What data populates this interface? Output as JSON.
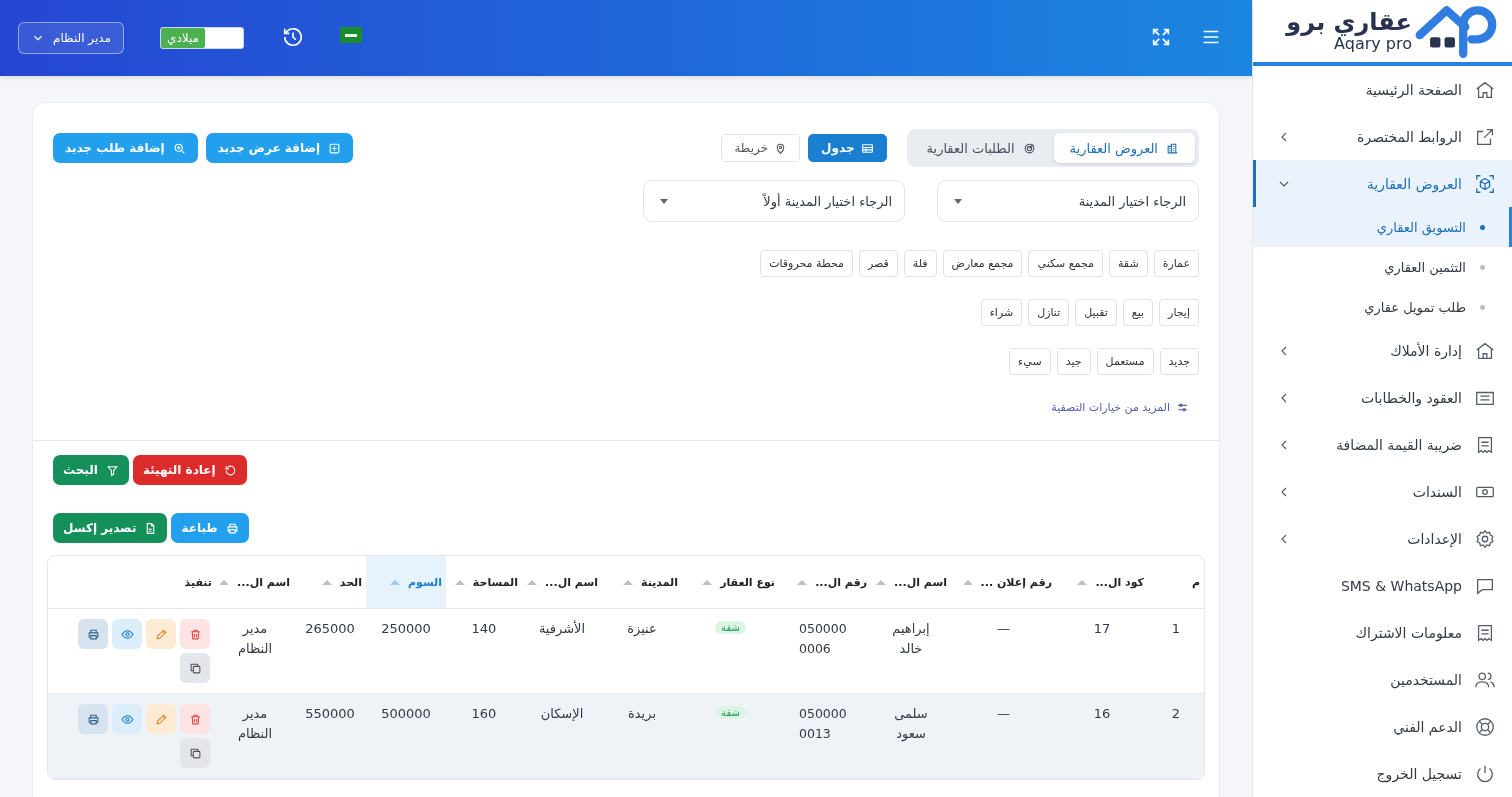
{
  "logo": {
    "arabic": "عقاري برو",
    "latin": "Aqary pro"
  },
  "sidebar": {
    "items": [
      {
        "label": "الصفحة الرئيسية",
        "expandable": false,
        "selected": false
      },
      {
        "label": "الروابط المختصرة",
        "expandable": true,
        "expanded": false,
        "selected": false
      },
      {
        "label": "العروض العقارية",
        "expandable": true,
        "expanded": true,
        "selected": true,
        "children": [
          {
            "label": "التسويق العقاري",
            "selected": true
          },
          {
            "label": "التثمين العقاري",
            "selected": false
          },
          {
            "label": "طلب تمويل عقاري",
            "selected": false
          }
        ]
      },
      {
        "label": "إدارة الأملاك",
        "expandable": true,
        "expanded": false,
        "selected": false
      },
      {
        "label": "العقود والخطابات",
        "expandable": true,
        "expanded": false,
        "selected": false
      },
      {
        "label": "ضريبة القيمة المضافة",
        "expandable": true,
        "expanded": false,
        "selected": false
      },
      {
        "label": "السندات",
        "expandable": true,
        "expanded": false,
        "selected": false
      },
      {
        "label": "الإعدادات",
        "expandable": true,
        "expanded": false,
        "selected": false
      },
      {
        "label": "SMS & WhatsApp",
        "expandable": false,
        "selected": false
      },
      {
        "label": "معلومات الاشتراك",
        "expandable": false,
        "selected": false
      },
      {
        "label": "المستخدمين",
        "expandable": false,
        "selected": false
      },
      {
        "label": "الدعم الفني",
        "expandable": false,
        "selected": false
      },
      {
        "label": "تسجيل الخروج",
        "expandable": false,
        "selected": false
      }
    ]
  },
  "header": {
    "calendar_toggle": {
      "label": "ميلادي",
      "on": true
    },
    "user_menu": {
      "label": "مدير النظام"
    }
  },
  "page": {
    "tabs": [
      {
        "label": "العروض العقارية",
        "selected": true
      },
      {
        "label": "الطلبات العقارية",
        "selected": false
      }
    ],
    "view_toggle": [
      {
        "label": "جدول",
        "selected": true
      },
      {
        "label": "خريطة",
        "selected": false
      }
    ],
    "add_buttons": [
      {
        "label": "إضافة عرض جديد",
        "kind": "offer"
      },
      {
        "label": "إضافة طلب جديد",
        "kind": "request"
      }
    ],
    "selects": [
      {
        "placeholder": "الرجاء اختيار المدينة"
      },
      {
        "placeholder": "الرجاء اختيار المدينة أولاً"
      }
    ],
    "chip_groups": [
      {
        "chips": [
          {
            "label": "عمارة",
            "selected": false
          },
          {
            "label": "شقة",
            "selected": false
          },
          {
            "label": "مجمع سكني",
            "selected": false
          },
          {
            "label": "مجمع معارض",
            "selected": false
          },
          {
            "label": "فلة",
            "selected": false
          },
          {
            "label": "قصر",
            "selected": false
          },
          {
            "label": "محطة محروقات",
            "selected": false
          }
        ]
      },
      {
        "chips": [
          {
            "label": "إيجار",
            "selected": false
          },
          {
            "label": "بيع",
            "selected": false
          },
          {
            "label": "تقبيل",
            "selected": false
          },
          {
            "label": "تنازل",
            "selected": false
          },
          {
            "label": "شراء",
            "selected": false
          }
        ]
      },
      {
        "chips": [
          {
            "label": "جديد",
            "selected": false
          },
          {
            "label": "مستعمل",
            "selected": false
          },
          {
            "label": "جيد",
            "selected": false
          },
          {
            "label": "سيء",
            "selected": false
          }
        ]
      }
    ],
    "more_filters": "المزيد من خيارات التصفية",
    "filter_buttons": [
      {
        "label": "إعادة التهيئة",
        "kind": "reset"
      },
      {
        "label": "البحث",
        "kind": "search"
      }
    ],
    "export_buttons": [
      {
        "label": "طباعة",
        "kind": "print"
      },
      {
        "label": "تصدير إكسل",
        "kind": "excel"
      }
    ],
    "table": {
      "columns": [
        {
          "label": "م",
          "kind": "text",
          "sortable": false,
          "sorted": false
        },
        {
          "label": "كود ال...",
          "kind": "text",
          "sortable": true,
          "sorted": false
        },
        {
          "label": "رقم إعلان ...",
          "kind": "text",
          "sortable": true,
          "sorted": false
        },
        {
          "label": "اسم ال...",
          "kind": "wrap",
          "sortable": true,
          "sorted": false
        },
        {
          "label": "رقم ال...",
          "kind": "phone",
          "sortable": true,
          "sorted": false
        },
        {
          "label": "نوع العقار",
          "kind": "badge",
          "sortable": true,
          "sorted": false
        },
        {
          "label": "المدينة",
          "kind": "text",
          "sortable": true,
          "sorted": false
        },
        {
          "label": "اسم ال...",
          "kind": "text",
          "sortable": true,
          "sorted": false
        },
        {
          "label": "المساحة",
          "kind": "text",
          "sortable": true,
          "sorted": false
        },
        {
          "label": "السوم",
          "kind": "text",
          "sortable": true,
          "sorted": true
        },
        {
          "label": "الحد",
          "kind": "text",
          "sortable": true,
          "sorted": false
        },
        {
          "label": "اسم ال...",
          "kind": "wrap",
          "sortable": true,
          "sorted": false
        },
        {
          "label": "تنفيذ",
          "kind": "actions",
          "sortable": false,
          "sorted": false
        }
      ],
      "rows": [
        {
          "highlighted": false,
          "cells": [
            "1",
            "17",
            "—",
            "إبراهيم خالد",
            "0500000006",
            "شقة",
            "عنيزة",
            "الأشرفية",
            "140",
            "250000",
            "265000",
            "مدير النظام"
          ]
        },
        {
          "highlighted": true,
          "cells": [
            "2",
            "16",
            "—",
            "سلمى سعود",
            "0500000013",
            "شقة",
            "بريدة",
            "الإسكان",
            "160",
            "500000",
            "550000",
            "مدير النظام"
          ]
        }
      ]
    }
  }
}
